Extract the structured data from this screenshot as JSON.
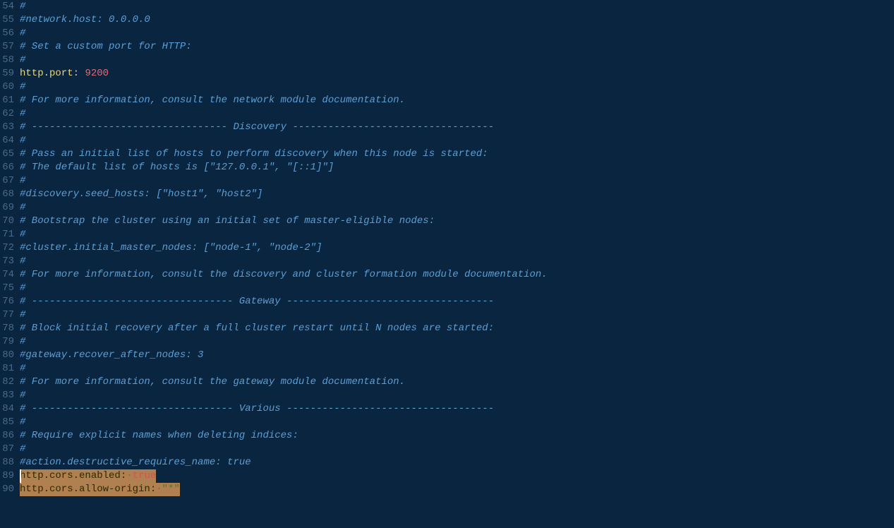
{
  "startLine": 54,
  "lines": [
    {
      "tokens": [
        {
          "t": "comment",
          "v": "#"
        }
      ]
    },
    {
      "tokens": [
        {
          "t": "comment",
          "v": "#network.host: 0.0.0.0"
        }
      ]
    },
    {
      "tokens": [
        {
          "t": "comment",
          "v": "#"
        }
      ]
    },
    {
      "tokens": [
        {
          "t": "comment",
          "v": "# Set a custom port for HTTP:"
        }
      ]
    },
    {
      "tokens": [
        {
          "t": "comment",
          "v": "#"
        }
      ]
    },
    {
      "tokens": [
        {
          "t": "key",
          "v": "http.port"
        },
        {
          "t": "colon",
          "v": ": "
        },
        {
          "t": "number",
          "v": "9200"
        }
      ]
    },
    {
      "tokens": [
        {
          "t": "comment",
          "v": "#"
        }
      ]
    },
    {
      "tokens": [
        {
          "t": "comment",
          "v": "# For more information, consult the network module documentation."
        }
      ]
    },
    {
      "tokens": [
        {
          "t": "comment",
          "v": "#"
        }
      ]
    },
    {
      "tokens": [
        {
          "t": "comment",
          "v": "# --------------------------------- Discovery ----------------------------------"
        }
      ]
    },
    {
      "tokens": [
        {
          "t": "comment",
          "v": "#"
        }
      ]
    },
    {
      "tokens": [
        {
          "t": "comment",
          "v": "# Pass an initial list of hosts to perform discovery when this node is started:"
        }
      ]
    },
    {
      "tokens": [
        {
          "t": "comment",
          "v": "# The default list of hosts is [\"127.0.0.1\", \"[::1]\"]"
        }
      ]
    },
    {
      "tokens": [
        {
          "t": "comment",
          "v": "#"
        }
      ]
    },
    {
      "tokens": [
        {
          "t": "comment",
          "v": "#discovery.seed_hosts: [\"host1\", \"host2\"]"
        }
      ]
    },
    {
      "tokens": [
        {
          "t": "comment",
          "v": "#"
        }
      ]
    },
    {
      "tokens": [
        {
          "t": "comment",
          "v": "# Bootstrap the cluster using an initial set of master-eligible nodes:"
        }
      ]
    },
    {
      "tokens": [
        {
          "t": "comment",
          "v": "#"
        }
      ]
    },
    {
      "tokens": [
        {
          "t": "comment",
          "v": "#cluster.initial_master_nodes: [\"node-1\", \"node-2\"]"
        }
      ]
    },
    {
      "tokens": [
        {
          "t": "comment",
          "v": "#"
        }
      ]
    },
    {
      "tokens": [
        {
          "t": "comment",
          "v": "# For more information, consult the discovery and cluster formation module documentation."
        }
      ]
    },
    {
      "tokens": [
        {
          "t": "comment",
          "v": "#"
        }
      ]
    },
    {
      "tokens": [
        {
          "t": "comment",
          "v": "# ---------------------------------- Gateway -----------------------------------"
        }
      ]
    },
    {
      "tokens": [
        {
          "t": "comment",
          "v": "#"
        }
      ]
    },
    {
      "tokens": [
        {
          "t": "comment",
          "v": "# Block initial recovery after a full cluster restart until N nodes are started:"
        }
      ]
    },
    {
      "tokens": [
        {
          "t": "comment",
          "v": "#"
        }
      ]
    },
    {
      "tokens": [
        {
          "t": "comment",
          "v": "#gateway.recover_after_nodes: 3"
        }
      ]
    },
    {
      "tokens": [
        {
          "t": "comment",
          "v": "#"
        }
      ]
    },
    {
      "tokens": [
        {
          "t": "comment",
          "v": "# For more information, consult the gateway module documentation."
        }
      ]
    },
    {
      "tokens": [
        {
          "t": "comment",
          "v": "#"
        }
      ]
    },
    {
      "tokens": [
        {
          "t": "comment",
          "v": "# ---------------------------------- Various -----------------------------------"
        }
      ]
    },
    {
      "tokens": [
        {
          "t": "comment",
          "v": "#"
        }
      ]
    },
    {
      "tokens": [
        {
          "t": "comment",
          "v": "# Require explicit names when deleting indices:"
        }
      ]
    },
    {
      "tokens": [
        {
          "t": "comment",
          "v": "#"
        }
      ]
    },
    {
      "tokens": [
        {
          "t": "comment",
          "v": "#action.destructive_requires_name: true"
        }
      ]
    },
    {
      "highlight": true,
      "cursor": true,
      "tokens": [
        {
          "t": "key",
          "v": "http.cors.enabled"
        },
        {
          "t": "colon",
          "v": ":"
        },
        {
          "t": "space",
          "v": "·"
        },
        {
          "t": "bool",
          "v": "true"
        }
      ]
    },
    {
      "highlight": true,
      "tokens": [
        {
          "t": "key",
          "v": "http.cors.allow-origin"
        },
        {
          "t": "colon",
          "v": ":"
        },
        {
          "t": "space",
          "v": "·"
        },
        {
          "t": "string",
          "v": "\"*\""
        }
      ]
    }
  ]
}
